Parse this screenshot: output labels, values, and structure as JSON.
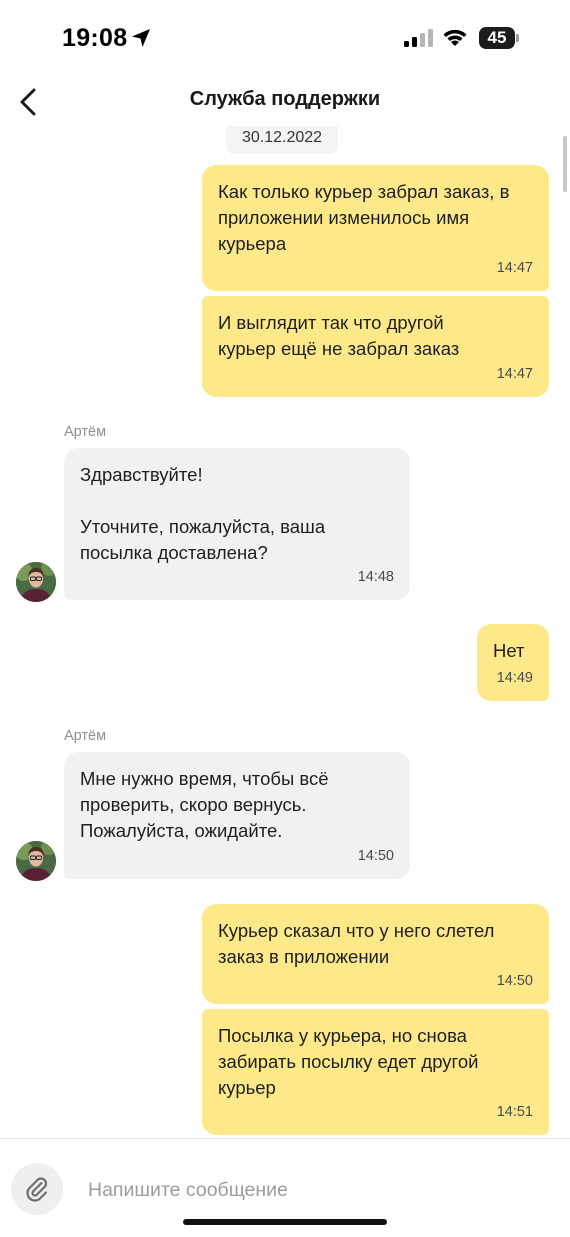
{
  "status_bar": {
    "time": "19:08",
    "battery": "45",
    "icons": [
      "location-arrow-icon",
      "cellular-signal-icon",
      "wifi-icon",
      "battery-icon"
    ]
  },
  "header": {
    "title": "Служба поддержки",
    "back_icon": "chevron-left-icon"
  },
  "chat": {
    "date": "30.12.2022",
    "messages": [
      {
        "direction": "out",
        "text": "Как только курьер забрал заказ, в\nприложении изменилось имя\nкурьера",
        "time": "14:47"
      },
      {
        "direction": "out",
        "text": "И выглядит так что другой\nкурьер ещё не забрал заказ",
        "time": "14:47"
      },
      {
        "direction": "in",
        "sender": "Артём",
        "text": "Здравствуйте!\n\nУточните, пожалуйста, ваша\nпосылка доставлена?",
        "time": "14:48"
      },
      {
        "direction": "out",
        "text": "Нет",
        "time": "14:49"
      },
      {
        "direction": "in",
        "sender": "Артём",
        "text": "Мне нужно время, чтобы всё\nпроверить, скоро вернусь.\nПожалуйста, ожидайте.",
        "time": "14:50"
      },
      {
        "direction": "out",
        "text": "Курьер сказал что у него слетел\nзаказ в приложении",
        "time": "14:50"
      },
      {
        "direction": "out",
        "text": "Посылка у курьера, но снова\nзабирать посылку едет другой\nкурьер",
        "time": "14:51"
      }
    ]
  },
  "input": {
    "placeholder": "Напишите сообщение",
    "value": "",
    "attach_icon": "paperclip-icon"
  },
  "colors": {
    "outgoing_bubble": "#fde98a",
    "incoming_bubble": "#f2f1ef"
  }
}
